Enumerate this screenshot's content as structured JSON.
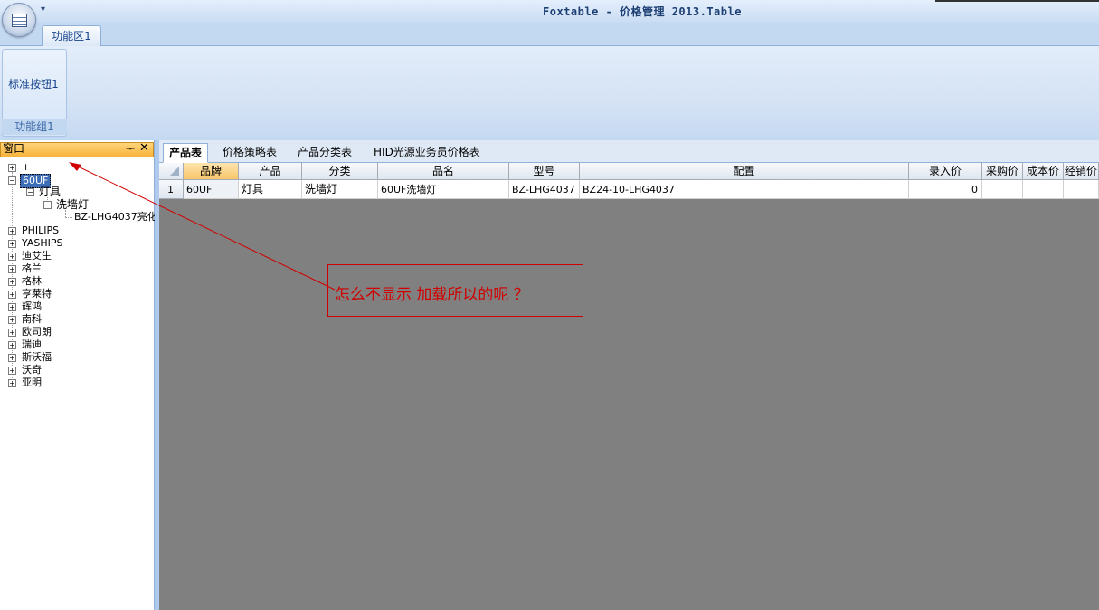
{
  "app": {
    "title": "Foxtable - 价格管理 2013.Table",
    "qat_glyph": "▾"
  },
  "ribbon": {
    "tab": "功能区1",
    "button": "标准按钮1",
    "group": "功能组1"
  },
  "panel": {
    "title": "窗口",
    "pin": "ᅮ",
    "close": "✕",
    "tree": {
      "root_plus": "+",
      "selected": "60UF",
      "child1": "灯具",
      "child2": "洗墙灯",
      "leaf": "BZ-LHG4037亮化'",
      "brands": [
        "PHILIPS",
        "YASHIPS",
        "迪艾生",
        "格兰",
        "格林",
        "亨莱特",
        "辉鸿",
        "南科",
        "欧司朗",
        "瑞迪",
        "斯沃福",
        "沃奇",
        "亚明"
      ]
    }
  },
  "table_tabs": [
    "产品表",
    "价格策略表",
    "产品分类表",
    "HID光源业务员价格表"
  ],
  "grid": {
    "columns": [
      "品牌",
      "产品",
      "分类",
      "品名",
      "型号",
      "配置",
      "录入价",
      "采购价",
      "成本价",
      "经销价"
    ],
    "rows": [
      {
        "num": "1",
        "cells": [
          "60UF",
          "灯具",
          "洗墙灯",
          "60UF洗墙灯",
          "BZ-LHG4037",
          "BZ24-10-LHG4037",
          "0",
          "",
          "",
          ""
        ]
      }
    ]
  },
  "annotation": {
    "text": "怎么不显示 加载所以的呢 ？",
    "color": "#d00000"
  },
  "colors": {
    "ribbon": "#c3d8f1",
    "grid_bg": "#808080",
    "panel_header": "#f7b33b",
    "selection": "#3d6db5"
  }
}
